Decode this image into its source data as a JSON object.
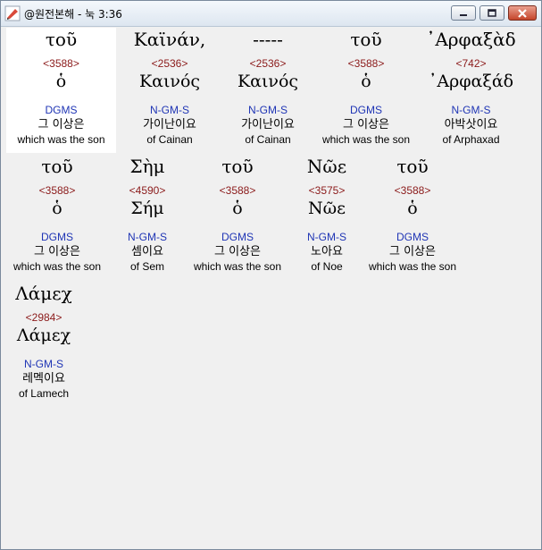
{
  "window": {
    "title": "@원전본해 - 눅 3:36"
  },
  "rows": [
    [
      {
        "greek": "τοῦ",
        "strong": "<3588>",
        "lemma": "ὁ",
        "parse": "DGMS",
        "korean": "그 이상은",
        "english": "which was the son"
      },
      {
        "greek": "Καϊνάν,",
        "strong": "<2536>",
        "lemma": "Καινός",
        "parse": "N-GM-S",
        "korean": "가이난이요",
        "english": "of Cainan"
      },
      {
        "greek": "-----",
        "strong": "<2536>",
        "lemma": "Καινός",
        "parse": "N-GM-S",
        "korean": "가이난이요",
        "english": "of Cainan"
      },
      {
        "greek": "τοῦ",
        "strong": "<3588>",
        "lemma": "ὁ",
        "parse": "DGMS",
        "korean": "그 이상은",
        "english": "which was the son"
      },
      {
        "greek": "᾿Αρφαξὰδ",
        "strong": "<742>",
        "lemma": "᾿Αρφαξάδ",
        "parse": "N-GM-S",
        "korean": "아박삿이요",
        "english": "of Arphaxad"
      }
    ],
    [
      {
        "greek": "τοῦ",
        "strong": "<3588>",
        "lemma": "ὁ",
        "parse": "DGMS",
        "korean": "그 이상은",
        "english": "which was the son"
      },
      {
        "greek": "Σὴμ",
        "strong": "<4590>",
        "lemma": "Σήμ",
        "parse": "N-GM-S",
        "korean": "셈이요",
        "english": "of Sem"
      },
      {
        "greek": "τοῦ",
        "strong": "<3588>",
        "lemma": "ὁ",
        "parse": "DGMS",
        "korean": "그 이상은",
        "english": "which was the son"
      },
      {
        "greek": "Νῶε",
        "strong": "<3575>",
        "lemma": "Νῶε",
        "parse": "N-GM-S",
        "korean": "노아요",
        "english": "of Noe"
      },
      {
        "greek": "τοῦ",
        "strong": "<3588>",
        "lemma": "ὁ",
        "parse": "DGMS",
        "korean": "그 이상은",
        "english": "which was the son"
      }
    ],
    [
      {
        "greek": "Λάμεχ",
        "strong": "<2984>",
        "lemma": "Λάμεχ",
        "parse": "N-GM-S",
        "korean": "레멕이요",
        "english": "of Lamech"
      }
    ]
  ]
}
